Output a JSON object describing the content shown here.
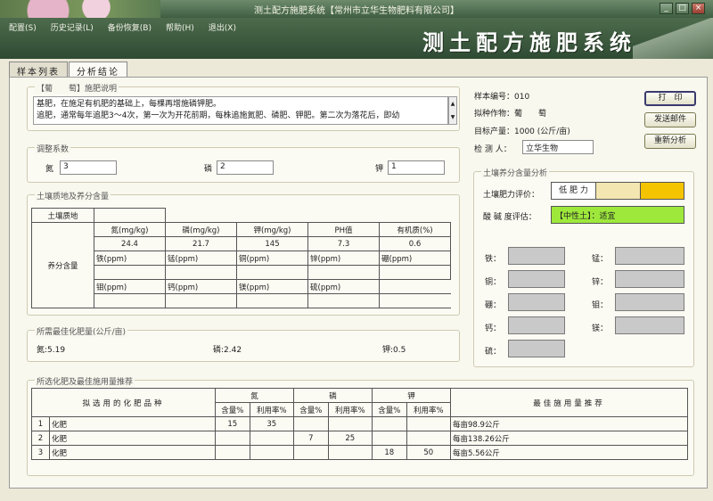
{
  "window": {
    "title": "测土配方施肥系统【常州市立华生物肥料有限公司】",
    "minimize": "_",
    "maximize": "□",
    "close": "×"
  },
  "menu": [
    "配置(S)",
    "历史记录(L)",
    "备份恢复(B)",
    "帮助(H)",
    "退出(X)"
  ],
  "app_title": "测土配方施肥系统",
  "tabs": [
    "样本列表",
    "分析结论"
  ],
  "fert_desc": {
    "label": "【葡　　萄】施肥说明",
    "line1": "基肥，在施足有机肥的基础上，每棵再增施磷钾肥。",
    "line2": "追肥，通常每年追肥3～4次，第一次为开花前期，每株追施氮肥、磷肥、钾肥。第二次为落花后，即幼"
  },
  "coef": {
    "label": "调整系数",
    "n_label": "氮",
    "n": "3",
    "p_label": "磷",
    "p": "2",
    "k_label": "钾",
    "k": "1"
  },
  "soil": {
    "label": "土壤质地及养分含量",
    "texture_label": "土壤质地",
    "nutrient_label": "养分含量",
    "h1": [
      "氮(mg/kg)",
      "磷(mg/kg)",
      "钾(mg/kg)",
      "PH值",
      "有机质(%)"
    ],
    "v1": [
      "24.4",
      "21.7",
      "145",
      "7.3",
      "0.6"
    ],
    "h2": [
      "铁(ppm)",
      "锰(ppm)",
      "铜(ppm)",
      "锌(ppm)",
      "硼(ppm)"
    ],
    "h3": [
      "钼(ppm)",
      "钙(ppm)",
      "镁(ppm)",
      "硫(ppm)"
    ]
  },
  "best": {
    "label": "所需最佳化肥量(公斤/亩)",
    "n": "氮:5.19",
    "p": "磷:2.42",
    "k": "钾:0.5"
  },
  "sample": {
    "id": "样本编号：010",
    "crop": "拟种作物：葡　　萄",
    "yield": "目标产量：1000 (公斤/亩)",
    "inspector_label": "检 测 人：",
    "inspector": "立华生物"
  },
  "buttons": {
    "print": "打　印",
    "mail": "发送邮件",
    "reanalyze": "重新分析"
  },
  "analysis": {
    "label": "土壤养分含量分析",
    "fert_label": "土壤肥力评价：",
    "fert_value": "低 肥 力",
    "ph_label": "酸 碱 度评估：",
    "ph_value": "【中性土】：适宜",
    "micro": [
      "铁：",
      "锰：",
      "铜：",
      "锌：",
      "硼：",
      "钼：",
      "钙：",
      "镁：",
      "硫："
    ]
  },
  "rec": {
    "label": "所选化肥及最佳施用量推荐",
    "h_name": "拟选用的化肥品种",
    "h_n": "氮",
    "h_p": "磷",
    "h_k": "钾",
    "h_content": "含量%",
    "h_rate": "利用率%",
    "h_best": "最佳施用量推荐",
    "rows": [
      {
        "no": "1",
        "name": "化肥",
        "n_c": "15",
        "n_r": "35",
        "p_c": "",
        "p_r": "",
        "k_c": "",
        "k_r": "",
        "amt": "每亩98.9公斤"
      },
      {
        "no": "2",
        "name": "化肥",
        "n_c": "",
        "n_r": "",
        "p_c": "7",
        "p_r": "25",
        "k_c": "",
        "k_r": "",
        "amt": "每亩138.26公斤"
      },
      {
        "no": "3",
        "name": "化肥",
        "n_c": "",
        "n_r": "",
        "p_c": "",
        "p_r": "",
        "k_c": "18",
        "k_r": "50",
        "amt": "每亩5.56公斤"
      }
    ]
  },
  "colors": {
    "fert_yellow": "#f5c400",
    "ph_green": "#9ee83c"
  }
}
